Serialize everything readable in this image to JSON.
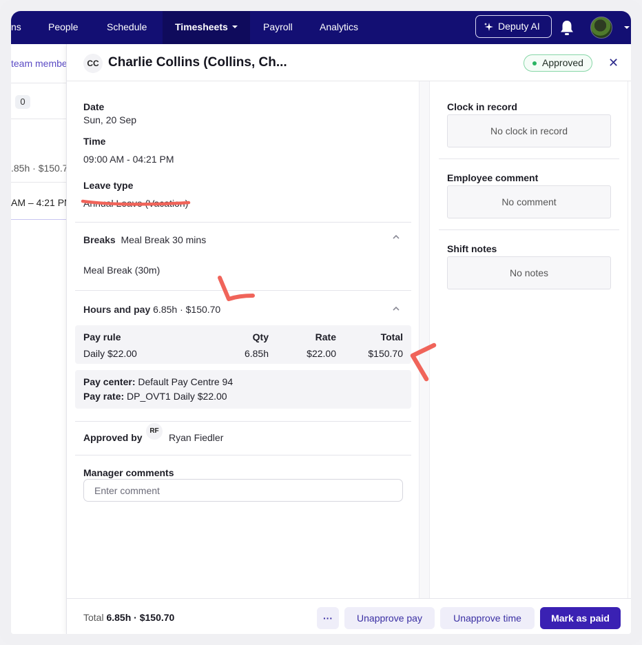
{
  "nav": {
    "partial_left": "ns",
    "items": [
      "People",
      "Schedule",
      "Timesheets",
      "Payroll",
      "Analytics"
    ],
    "ai_button": "Deputy AI"
  },
  "background": {
    "team_link": "team membe",
    "count": "0",
    "hours": ".85h · $150.7",
    "time": "AM – 4:21 PM"
  },
  "modal": {
    "avatar_initials": "CC",
    "title": "Charlie Collins (Collins, Ch...",
    "status": "Approved",
    "close_symbol": "✕",
    "date_label": "Date",
    "date_value": "Sun, 20 Sep",
    "time_label": "Time",
    "time_value": "09:00 AM - 04:21 PM",
    "leave_label": "Leave type",
    "leave_value": "Annual Leave (Vacation)",
    "breaks_label": "Breaks",
    "breaks_summary": "Meal Break 30 mins",
    "break_item": "Meal Break (30m)",
    "hours_label": "Hours and pay",
    "hours_summary": "6.85h  · $150.70",
    "pay_table": {
      "headers": [
        "Pay rule",
        "Qty",
        "Rate",
        "Total"
      ],
      "row": [
        "Daily $22.00",
        "6.85h",
        "$22.00",
        "$150.70"
      ]
    },
    "pay_center_label": "Pay center:",
    "pay_center_value": "Default Pay Centre 94",
    "pay_rate_label": "Pay rate:",
    "pay_rate_value": "DP_OVT1 Daily $22.00",
    "approved_by_label": "Approved by",
    "approver_initials": "RF",
    "approver_name": "Ryan Fiedler",
    "manager_comments_label": "Manager comments",
    "comment_placeholder": "Enter comment",
    "right": {
      "clock_label": "Clock in record",
      "clock_value": "No clock in record",
      "employee_comment_label": "Employee comment",
      "employee_comment_value": "No comment",
      "shift_notes_label": "Shift notes",
      "shift_notes_value": "No notes"
    },
    "footer": {
      "total_prefix": "Total",
      "total_value": "6.85h · $150.70",
      "more": "···",
      "unapprove_pay": "Unapprove pay",
      "unapprove_time": "Unapprove time",
      "mark_paid": "Mark as paid"
    }
  },
  "colors": {
    "nav_bg": "#130f73",
    "primary": "#3a21b3",
    "annotation": "#f0645a",
    "status_green": "#2bb463"
  }
}
